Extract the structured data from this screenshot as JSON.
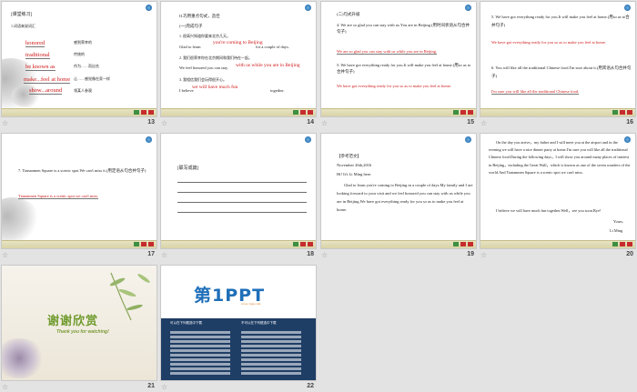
{
  "accent_red": "#d01818",
  "slides": {
    "s13": {
      "number": "13",
      "header": "[课堂练习]",
      "sub": "1.词语来说词汇",
      "en": [
        "honored",
        "traditional",
        "be known as",
        "make...feel at home",
        "show...around"
      ],
      "cn": [
        "感到荣幸的",
        "传统的",
        "作为……而出名",
        "让……感觉像在家一样",
        "领某人参观"
      ]
    },
    "s14": {
      "number": "14",
      "title": "II.巧用重点句式，造佳",
      "sub": "(一)完成句子",
      "q1": "1. 很高兴知道你要来北京几天。",
      "l1a": "Glad to learn",
      "a1": "you're coming to Beijing",
      "l1b": "for a couple of days.",
      "q2": "2. 我们很荣幸你在北京期间和我们待在一起。",
      "l2": "We feel honored you can stay",
      "a2": "with us while you are in Beijing",
      "q3": "3. 我相信我们会玩得很开心。",
      "l3": "I believe",
      "a3": "we will have much fun",
      "l3b": "together."
    },
    "s15": {
      "number": "15",
      "sub": "(二)句式升级",
      "q4": "4. We are so glad you can stay with us.You are in Beijing.(用时间状语从句合并句子)",
      "a4": "We are so glad you can stay with us while you are in Beijing.",
      "q5": "5. We have got everything ready for you.It will make you feel at home.(用so as to合并句子)",
      "a5": "We have got everything ready for you so as to make you feel at home."
    },
    "s16": {
      "number": "16",
      "q5": "5. We have got everything ready for you.It will make you feel at home.(用so as to合并句子)",
      "a5": "We have got everything ready for you so as to make you feel at home.",
      "q6": "6. You will like all the traditional Chinese food.I'm sure about it.(用宾语从句合并句子)",
      "a6": "I'm sure you will like all the traditional Chinese food."
    },
    "s17": {
      "number": "17",
      "q7": "7. Tiananmen Square is a scenic spot.We can't miss it.(用定语从句合并句子)",
      "a7": "Tiananmen Square is a scenic spot we can't miss."
    },
    "s18": {
      "number": "18",
      "header": "[联写成篇]"
    },
    "s19": {
      "number": "19",
      "header": "【参考范文】",
      "date": "November 26th,2016",
      "greet": "Hi! It's Li Ming here.",
      "body": "Glad to learn you're coming to Beijing in a couple of days.My family and I are looking forward to your visit and we feel honored you can stay with us while you are in Beijing.We have got everything ready for you so as to make you feel at home."
    },
    "s20": {
      "number": "20",
      "body": "On the day you arrive，my father and I will meet you at the airport and in the evening we will have a nice dinner party at home.I'm sure you will like all the traditional Chinese food.During the following days，I will show you around many places of interest in Beijing，including the Great Wall，which is known as one of the seven wonders of the world.And Tiananmen Square is a scenic spot we can't miss.",
      "close": "I believe we will have much fun together.Well，see you soon.Bye!",
      "sign1": "Yours,",
      "sign2": "Li Ming"
    },
    "s21": {
      "number": "21",
      "title": "谢谢欣赏",
      "subtitle": "Thank you for watching!"
    },
    "s22": {
      "number": "22",
      "logo": "第1PPT",
      "url": "www.1ppt.com",
      "left_label": "可以在下列框选中下载",
      "right_label": "不可以在下列框选中下载"
    }
  }
}
